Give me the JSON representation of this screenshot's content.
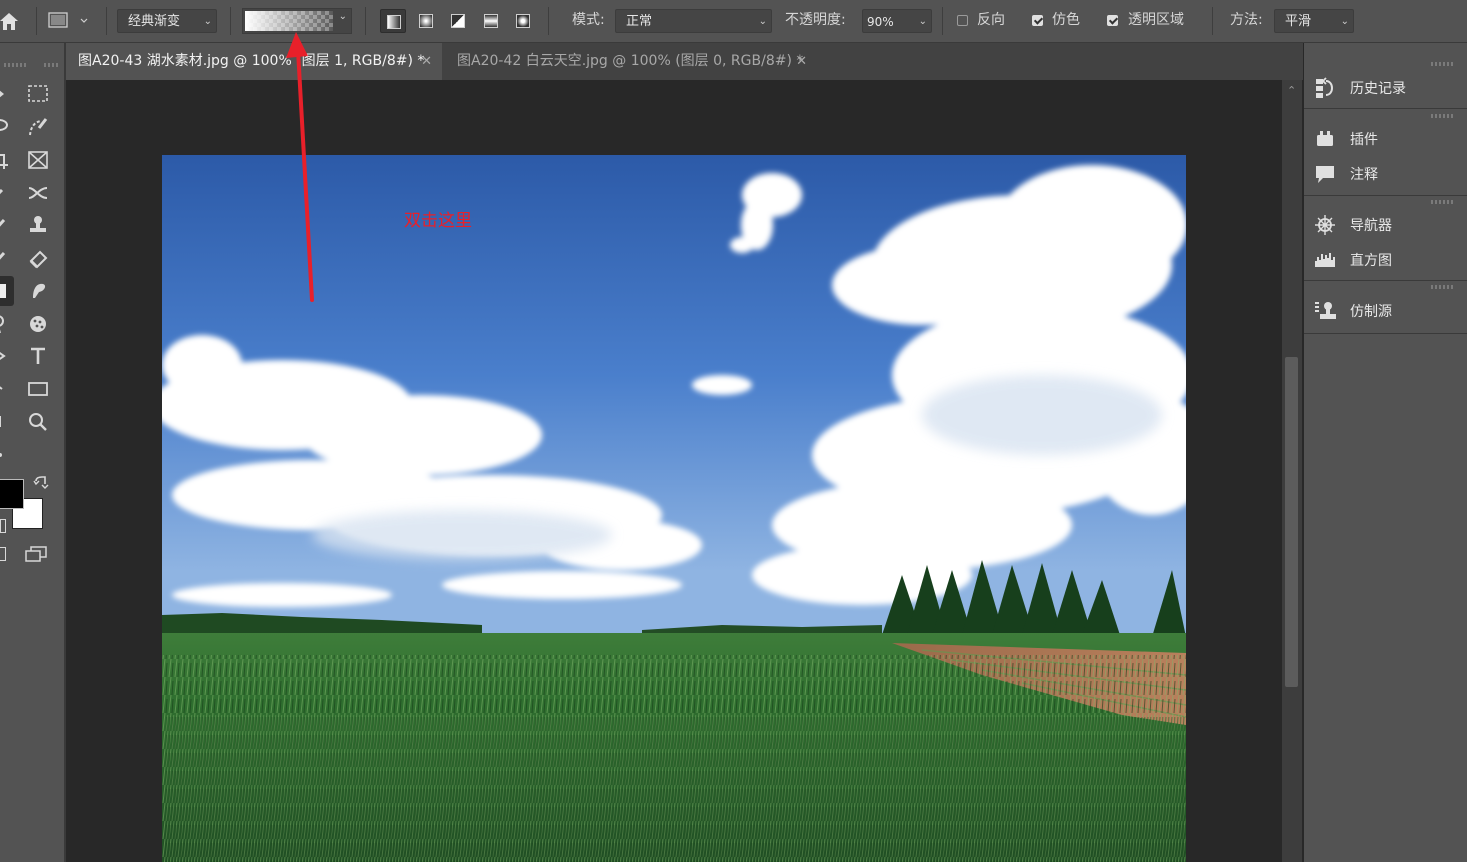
{
  "options_bar": {
    "preset_label": "经典渐变",
    "mode_label": "模式:",
    "mode_value": "正常",
    "opacity_label": "不透明度:",
    "opacity_value": "90%",
    "reverse_label": "反向",
    "reverse_checked": false,
    "dither_label": "仿色",
    "dither_checked": true,
    "transparency_label": "透明区域",
    "transparency_checked": true,
    "method_label": "方法:",
    "method_value": "平滑"
  },
  "tabs": [
    {
      "label": "图A20-43 湖水素材.jpg @ 100% (图层 1, RGB/8#) *",
      "active": true
    },
    {
      "label": "图A20-42 白云天空.jpg @ 100% (图层 0, RGB/8#) *",
      "active": false
    }
  ],
  "annotation": {
    "text": "双击这里",
    "color": "#e8202a"
  },
  "panels": {
    "history": "历史记录",
    "plugins": "插件",
    "comments": "注释",
    "navigator": "导航器",
    "histogram": "直方图",
    "clone_source": "仿制源"
  },
  "colors": {
    "foreground": "#000000",
    "background": "#ffffff"
  }
}
